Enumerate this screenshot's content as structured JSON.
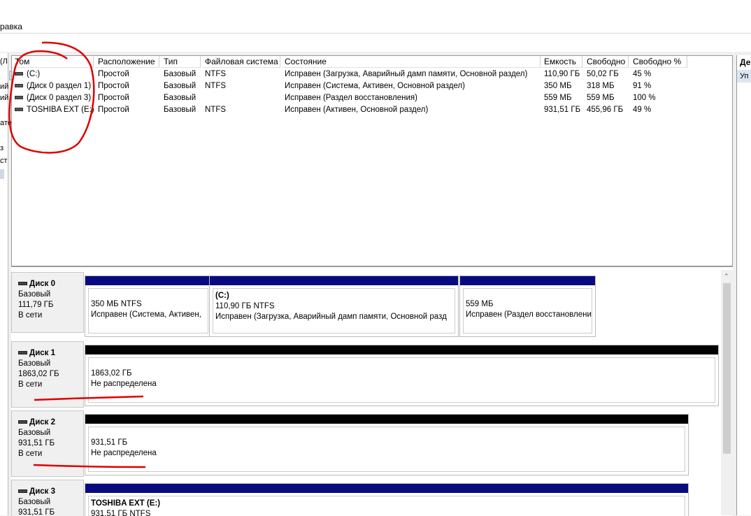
{
  "menu": {
    "action_label": "равка"
  },
  "toolbar": {
    "icons": [
      "console-icon",
      "check-icon",
      "properties-icon"
    ]
  },
  "left_strip": {
    "fragments": [
      "(Л",
      "ий",
      "ий",
      "ате",
      "з",
      "ст"
    ]
  },
  "right_pane": {
    "header": "Де",
    "item": "Уп"
  },
  "volume_list": {
    "columns": [
      "Том",
      "Расположение",
      "Тип",
      "Файловая система",
      "Состояние",
      "Емкость",
      "Свободно",
      "Свободно %"
    ],
    "rows": [
      [
        "(C:)",
        "Простой",
        "Базовый",
        "NTFS",
        "Исправен (Загрузка, Аварийный дамп памяти, Основной раздел)",
        "110,90 ГБ",
        "50,02 ГБ",
        "45 %"
      ],
      [
        "(Диск 0 раздел 1)",
        "Простой",
        "Базовый",
        "NTFS",
        "Исправен (Система, Активен, Основной раздел)",
        "350 МБ",
        "318 МБ",
        "91 %"
      ],
      [
        "(Диск 0 раздел 3)",
        "Простой",
        "Базовый",
        "",
        "Исправен (Раздел восстановления)",
        "559 МБ",
        "559 МБ",
        "100 %"
      ],
      [
        "TOSHIBA EXT (E:)",
        "Простой",
        "Базовый",
        "NTFS",
        "Исправен (Активен, Основной раздел)",
        "931,51 ГБ",
        "455,96 ГБ",
        "49 %"
      ]
    ]
  },
  "disks": [
    {
      "name": "Диск 0",
      "type": "Базовый",
      "size": "111,79 ГБ",
      "status": "В сети",
      "partitions": [
        {
          "title": "",
          "line1": "350 МБ NTFS",
          "line2": "Исправен (Система, Активен,",
          "bar_color": "#0a0a80"
        },
        {
          "title": "(C:)",
          "line1": "110,90 ГБ NTFS",
          "line2": "Исправен (Загрузка, Аварийный дамп памяти, Основной разд",
          "bar_color": "#0a0a80"
        },
        {
          "title": "",
          "line1": "559 МБ",
          "line2": "Исправен (Раздел восстановлени",
          "bar_color": "#0a0a80"
        }
      ]
    },
    {
      "name": "Диск 1",
      "type": "Базовый",
      "size": "1863,02 ГБ",
      "status": "В сети",
      "partitions": [
        {
          "title": "",
          "line1": "1863,02 ГБ",
          "line2": "Не распределена",
          "bar_color": "#000000"
        }
      ]
    },
    {
      "name": "Диск 2",
      "type": "Базовый",
      "size": "931,51 ГБ",
      "status": "В сети",
      "partitions": [
        {
          "title": "",
          "line1": "931,51 ГБ",
          "line2": "Не распределена",
          "bar_color": "#000000"
        }
      ]
    },
    {
      "name": "Диск 3",
      "type": "Базовый",
      "size": "931,51 ГБ",
      "status": "",
      "partitions": [
        {
          "title": "TOSHIBA EXT  (E:)",
          "line1": "931,51 ГБ NTFS",
          "line2": "",
          "bar_color": "#0a0a80"
        }
      ]
    }
  ],
  "annotation_color": "#e00000"
}
